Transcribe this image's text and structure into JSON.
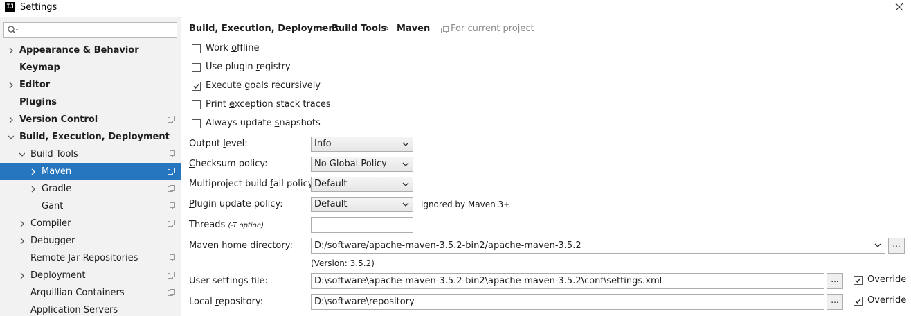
{
  "window": {
    "logo_text": "IJ",
    "title": "Settings"
  },
  "sidebar": {
    "search": {
      "value": "",
      "placeholder": ""
    },
    "items": [
      {
        "label": "Appearance & Behavior",
        "bold": true,
        "arrow": "right",
        "project_icon": false
      },
      {
        "label": "Keymap",
        "bold": true,
        "arrow": "none",
        "project_icon": false
      },
      {
        "label": "Editor",
        "bold": true,
        "arrow": "right",
        "project_icon": false
      },
      {
        "label": "Plugins",
        "bold": true,
        "arrow": "none",
        "project_icon": false
      },
      {
        "label": "Version Control",
        "bold": true,
        "arrow": "right",
        "project_icon": true
      },
      {
        "label": "Build, Execution, Deployment",
        "bold": true,
        "arrow": "down",
        "project_icon": false
      },
      {
        "label": "Build Tools",
        "bold": false,
        "arrow": "down",
        "project_icon": true
      },
      {
        "label": "Maven",
        "bold": false,
        "arrow": "right",
        "project_icon": true,
        "selected": true
      },
      {
        "label": "Gradle",
        "bold": false,
        "arrow": "right",
        "project_icon": true
      },
      {
        "label": "Gant",
        "bold": false,
        "arrow": "none",
        "project_icon": true
      },
      {
        "label": "Compiler",
        "bold": false,
        "arrow": "right",
        "project_icon": true
      },
      {
        "label": "Debugger",
        "bold": false,
        "arrow": "right",
        "project_icon": false
      },
      {
        "label": "Remote Jar Repositories",
        "bold": false,
        "arrow": "none",
        "project_icon": true
      },
      {
        "label": "Deployment",
        "bold": false,
        "arrow": "right",
        "project_icon": true
      },
      {
        "label": "Arquillian Containers",
        "bold": false,
        "arrow": "none",
        "project_icon": true
      },
      {
        "label": "Application Servers",
        "bold": false,
        "arrow": "none",
        "project_icon": false
      }
    ]
  },
  "breadcrumb": {
    "items": [
      "Build, Execution, Deployment",
      "Build Tools",
      "Maven"
    ],
    "separator": "›",
    "scope_note": "For current project"
  },
  "checkboxes": [
    {
      "pre": "Work ",
      "mnemonic": "o",
      "post": "ffline",
      "checked": false
    },
    {
      "pre": "Use plugin ",
      "mnemonic": "r",
      "post": "egistry",
      "checked": false
    },
    {
      "pre": "Execute ",
      "mnemonic": "g",
      "post": "oals recursively",
      "checked": true
    },
    {
      "pre": "Print ",
      "mnemonic": "e",
      "post": "xception stack traces",
      "checked": false
    },
    {
      "pre": "Always update ",
      "mnemonic": "s",
      "post": "napshots",
      "checked": false
    }
  ],
  "fields": {
    "output_level": {
      "pre": "Output ",
      "mnemonic": "l",
      "post": "evel:",
      "value": "Info"
    },
    "checksum_policy": {
      "pre": "",
      "mnemonic": "C",
      "post": "hecksum policy:",
      "value": "No Global Policy"
    },
    "fail_policy": {
      "pre": "Multiproject build ",
      "mnemonic": "f",
      "post": "ail policy:",
      "value": "Default"
    },
    "plugin_update": {
      "pre": "",
      "mnemonic": "P",
      "post": "lugin update policy:",
      "value": "Default",
      "note": "ignored by Maven 3+"
    },
    "threads": {
      "label": "Threads ",
      "hint": "(-T option)",
      "value": ""
    },
    "maven_home": {
      "pre": "Maven ",
      "mnemonic": "h",
      "post": "ome directory:",
      "value": "D:/software/apache-maven-3.5.2-bin2/apache-maven-3.5.2",
      "version": "(Version: 3.5.2)"
    },
    "user_settings": {
      "label": "User settings file:",
      "value": "D:\\software\\apache-maven-3.5.2-bin2\\apache-maven-3.5.2\\conf\\settings.xml",
      "override_label": "Override",
      "override_checked": true
    },
    "local_repo": {
      "pre": "Local ",
      "mnemonic": "r",
      "post": "epository:",
      "value": "D:\\software\\repository",
      "override_label": "Override",
      "override_checked": true
    }
  },
  "buttons": {
    "browse_label": "..."
  },
  "colors": {
    "selection": "#2675bf",
    "sidebar_bg": "#f2f2f2"
  }
}
